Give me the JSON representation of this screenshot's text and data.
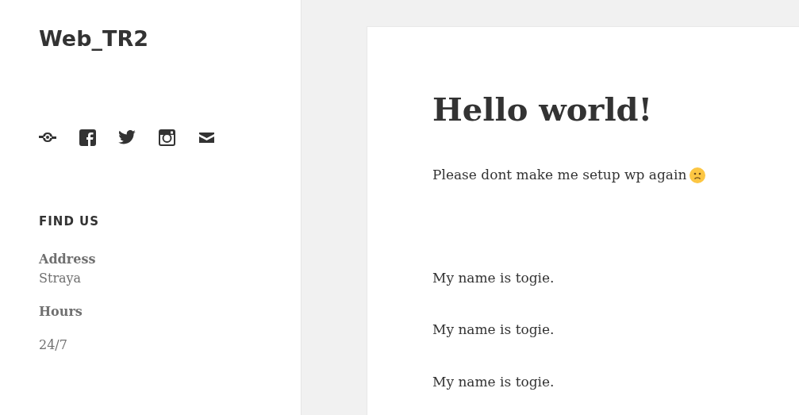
{
  "site_title": "Web_TR2",
  "social_links": [
    {
      "kind": "link"
    },
    {
      "kind": "facebook"
    },
    {
      "kind": "bird"
    },
    {
      "kind": "camera"
    },
    {
      "kind": "mail"
    }
  ],
  "widget": {
    "title": "FIND US",
    "entries": [
      {
        "label": "Address",
        "value": "Straya"
      },
      {
        "label": "Hours",
        "value": "24/7"
      }
    ]
  },
  "post": {
    "title": "Hello world!",
    "intro": "Please dont make me setup wp again",
    "intro_icon": {
      "kind": "frown"
    },
    "paragraphs": [
      "My name is togie.",
      "My name is togie.",
      "My name is togie."
    ]
  }
}
